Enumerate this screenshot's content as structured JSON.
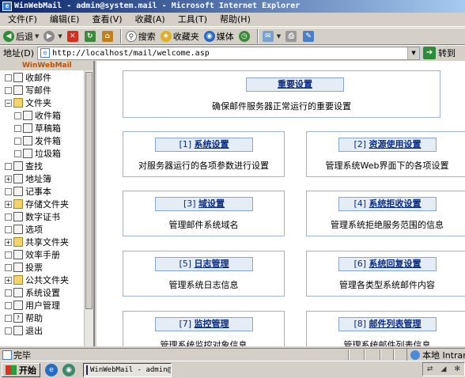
{
  "window": {
    "title": "WinWebMail - admin@system.mail - Microsoft Internet Explorer"
  },
  "menu": [
    "文件(F)",
    "编辑(E)",
    "查看(V)",
    "收藏(A)",
    "工具(T)",
    "帮助(H)"
  ],
  "toolbar": {
    "back": "后退",
    "search": "搜索",
    "favorites": "收藏夹",
    "media": "媒体"
  },
  "address": {
    "label": "地址(D)",
    "url": "http://localhost/mail/welcome.asp",
    "go": "转到"
  },
  "sidebar": {
    "header": "WinWebMail",
    "items": [
      {
        "label": "收邮件"
      },
      {
        "label": "写邮件"
      },
      {
        "label": "文件夹"
      },
      {
        "label": "收件箱"
      },
      {
        "label": "草稿箱"
      },
      {
        "label": "发件箱"
      },
      {
        "label": "垃圾箱"
      },
      {
        "label": "查找"
      },
      {
        "label": "地址簿"
      },
      {
        "label": "记事本"
      },
      {
        "label": "存储文件夹"
      },
      {
        "label": "数字证书"
      },
      {
        "label": "选项"
      },
      {
        "label": "共享文件夹"
      },
      {
        "label": "效率手册"
      },
      {
        "label": "投票"
      },
      {
        "label": "公共文件夹"
      },
      {
        "label": "系统设置"
      },
      {
        "label": "用户管理"
      },
      {
        "label": "帮助"
      },
      {
        "label": "退出"
      }
    ]
  },
  "main": {
    "top_card": {
      "title": "重要设置",
      "desc": "确保邮件服务器正常运行的重要设置"
    },
    "cards": [
      {
        "num": "[1]",
        "title": "系统设置",
        "desc": "对服务器运行的各项参数进行设置"
      },
      {
        "num": "[2]",
        "title": "资源使用设置",
        "desc": "管理系统Web界面下的各项设置"
      },
      {
        "num": "[3]",
        "title": "域设置",
        "desc": "管理邮件系统域名"
      },
      {
        "num": "[4]",
        "title": "系统拒收设置",
        "desc": "管理系统拒绝服务范围的信息"
      },
      {
        "num": "[5]",
        "title": "日志管理",
        "desc": "管理系统日志信息"
      },
      {
        "num": "[6]",
        "title": "系统回复设置",
        "desc": "管理各类型系统邮件内容"
      },
      {
        "num": "[7]",
        "title": "监控管理",
        "desc": "管理系统监控对象信息"
      },
      {
        "num": "[8]",
        "title": "邮件列表管理",
        "desc": "管理系统邮件列表信息"
      }
    ]
  },
  "status": {
    "text": "完毕",
    "zone": "本地 Intranet"
  },
  "taskbar": {
    "start": "开始",
    "task": "WinWebMail - admin@..."
  }
}
